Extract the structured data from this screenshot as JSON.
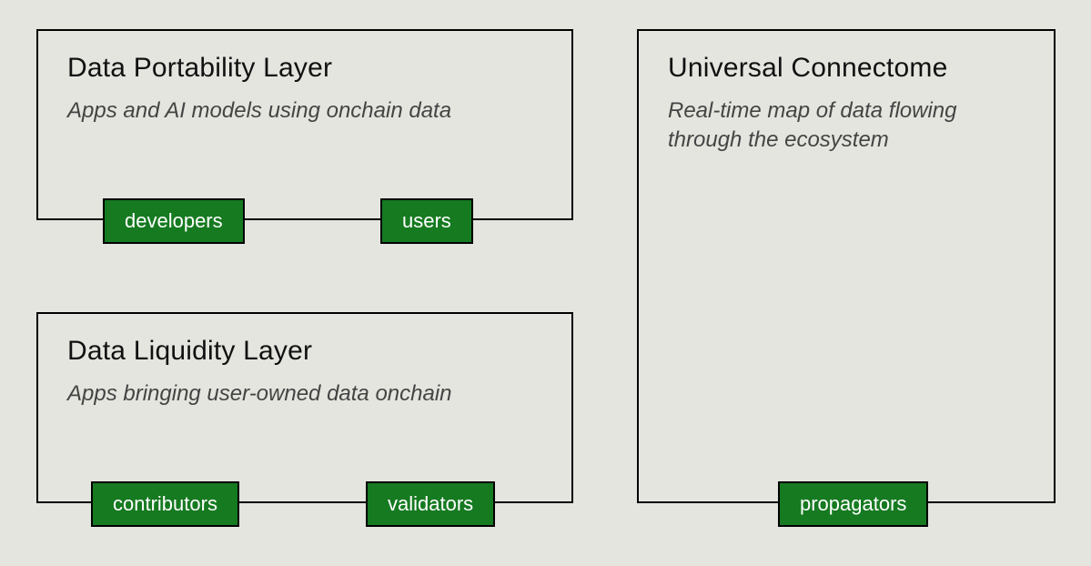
{
  "panels": {
    "portability": {
      "title": "Data Portability Layer",
      "desc": "Apps and AI models using onchain data",
      "tags": {
        "left": "developers",
        "right": "users"
      }
    },
    "liquidity": {
      "title": "Data Liquidity Layer",
      "desc": "Apps bringing user-owned data onchain",
      "tags": {
        "left": "contributors",
        "right": "validators"
      }
    },
    "connectome": {
      "title": "Universal Connectome",
      "desc": "Real-time map of data flowing through the ecosystem",
      "tags": {
        "bottom": "propagators"
      }
    }
  }
}
